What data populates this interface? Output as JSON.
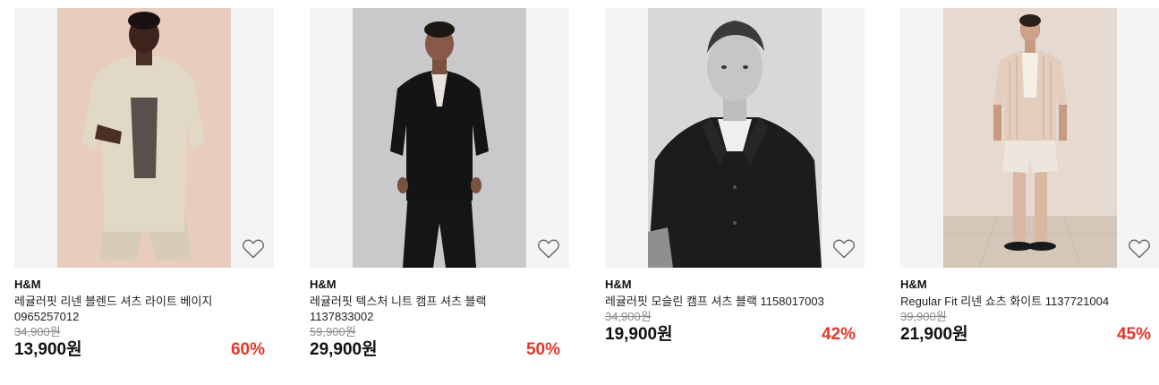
{
  "products": [
    {
      "brand": "H&M",
      "name": "레귤러핏 리넨 블렌드 셔츠 라이트 베이지",
      "name_line2": "0965257012",
      "original_price": "34,900원",
      "price": "13,900원",
      "discount": "60%",
      "photo": "man in beige linen shirt and shorts on pink background",
      "wishlist_icon": "heart-outline-icon"
    },
    {
      "brand": "H&M",
      "name": "레귤러핏 텍스처 니트 캠프 셔츠 블랙",
      "name_line2": "1137833002",
      "original_price": "59,900원",
      "price": "29,900원",
      "discount": "50%",
      "photo": "man in black knit camp shirt and black trousers on grey background",
      "wishlist_icon": "heart-outline-icon"
    },
    {
      "brand": "H&M",
      "name": "레귤러핏 모슬린 캠프 셔츠 블랙 1158017003",
      "original_price": "34,900원",
      "price": "19,900원",
      "discount": "42%",
      "photo": "black and white portrait of man in black camp shirt",
      "wishlist_icon": "heart-outline-icon"
    },
    {
      "brand": "H&M",
      "name": "Regular Fit 리넨 쇼츠 화이트 1137721004",
      "original_price": "39,900원",
      "price": "21,900원",
      "discount": "45%",
      "photo": "man in striped shirt and white linen shorts with black sandals",
      "wishlist_icon": "heart-outline-icon"
    }
  ],
  "colors": {
    "discount": "#e2372b",
    "thumb_bg": "#f4f4f4"
  }
}
